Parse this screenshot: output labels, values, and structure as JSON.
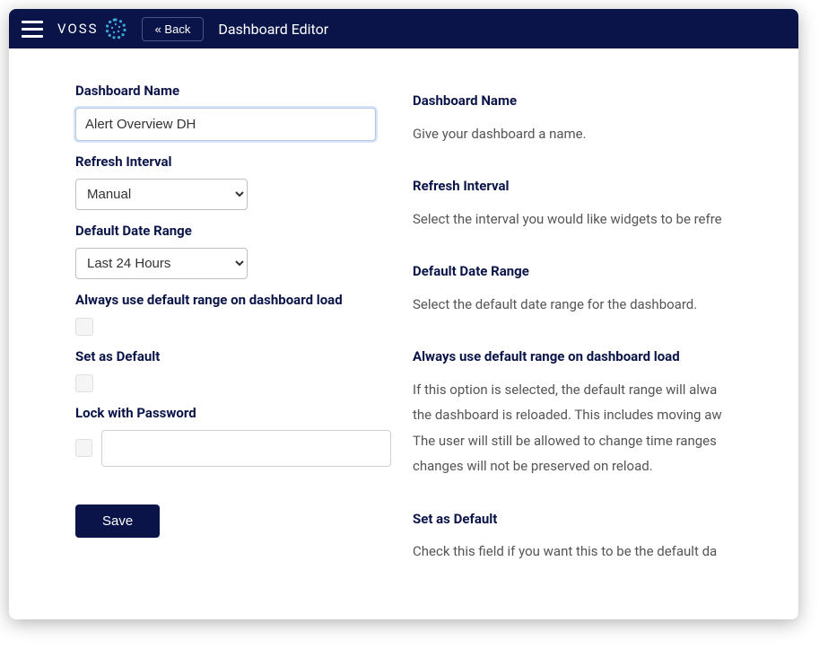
{
  "header": {
    "logo_text": "VOSS",
    "back_label": "« Back",
    "title": "Dashboard Editor"
  },
  "form": {
    "dashboard_name": {
      "label": "Dashboard Name",
      "value": "Alert Overview DH"
    },
    "refresh_interval": {
      "label": "Refresh Interval",
      "value": "Manual"
    },
    "default_date_range": {
      "label": "Default Date Range",
      "value": "Last 24 Hours"
    },
    "always_use_default": {
      "label": "Always use default range on dashboard load",
      "checked": false
    },
    "set_as_default": {
      "label": "Set as Default",
      "checked": false
    },
    "lock_password": {
      "label": "Lock with Password",
      "checked": false,
      "value": ""
    },
    "save_label": "Save"
  },
  "help": {
    "dashboard_name": {
      "title": "Dashboard Name",
      "text": "Give your dashboard a name."
    },
    "refresh_interval": {
      "title": "Refresh Interval",
      "text": "Select the interval you would like widgets to be refre"
    },
    "default_date_range": {
      "title": "Default Date Range",
      "text": "Select the default date range for the dashboard."
    },
    "always_use_default": {
      "title": "Always use default range on dashboard load",
      "line1": "If this option is selected, the default range will alwa",
      "line2": "the dashboard is reloaded. This includes moving aw",
      "line3": "The user will still be allowed to change time ranges",
      "line4": "changes will not be preserved on reload."
    },
    "set_as_default": {
      "title": "Set as Default",
      "text": "Check this field if you want this to be the default da"
    }
  }
}
